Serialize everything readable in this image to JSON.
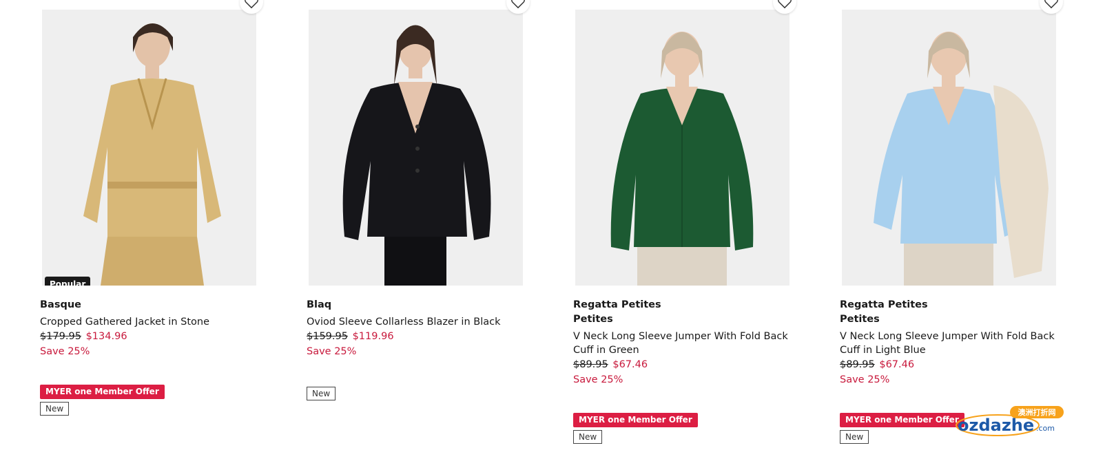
{
  "products": [
    {
      "brand": "Basque",
      "brand_line2": "",
      "name": "Cropped Gathered Jacket in Stone",
      "was_price": "$179.95",
      "now_price": "$134.96",
      "save": "Save 25%",
      "image_badge": "Popular",
      "member_badge": "MYER one Member Offer",
      "new_badge": "New",
      "garment_color": "#d8b878"
    },
    {
      "brand": "Blaq",
      "brand_line2": "",
      "name": "Oviod Sleeve Collarless Blazer in Black",
      "was_price": "$159.95",
      "now_price": "$119.96",
      "save": "Save 25%",
      "image_badge": "",
      "member_badge": "",
      "new_badge": "New",
      "garment_color": "#16161a"
    },
    {
      "brand": "Regatta Petites",
      "brand_line2": "Petites",
      "name": "V Neck Long Sleeve Jumper With Fold Back Cuff in Green",
      "was_price": "$89.95",
      "now_price": "$67.46",
      "save": "Save 25%",
      "image_badge": "",
      "member_badge": "MYER one Member Offer",
      "new_badge": "New",
      "garment_color": "#1c5a32"
    },
    {
      "brand": "Regatta Petites",
      "brand_line2": "Petites",
      "name": "V Neck Long Sleeve Jumper With Fold Back Cuff in Light Blue",
      "was_price": "$89.95",
      "now_price": "$67.46",
      "save": "Save 25%",
      "image_badge": "",
      "member_badge": "MYER one Member Offer",
      "new_badge": "New",
      "garment_color": "#a8d0ee"
    }
  ],
  "icons": {
    "wishlist": "heart-outline-icon"
  },
  "watermark": {
    "text": "ozdazhe",
    "suffix": ".com",
    "cn": "澳洲打折网"
  },
  "colors": {
    "sale_red": "#c8193c",
    "member_red": "#dc1e43"
  }
}
